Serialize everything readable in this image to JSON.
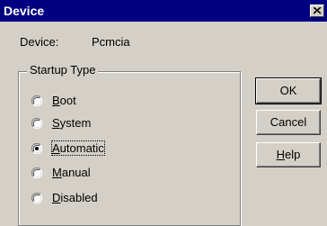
{
  "window": {
    "title": "Device"
  },
  "device": {
    "label": "Device:",
    "value": "Pcmcia"
  },
  "startup": {
    "group_label": "Startup Type",
    "options": [
      {
        "accel": "B",
        "rest": "oot",
        "selected": false
      },
      {
        "accel": "S",
        "rest": "ystem",
        "selected": false
      },
      {
        "accel": "A",
        "rest": "utomatic",
        "selected": true
      },
      {
        "accel": "M",
        "rest": "anual",
        "selected": false
      },
      {
        "accel": "D",
        "rest": "isabled",
        "selected": false
      }
    ]
  },
  "buttons": {
    "ok": "OK",
    "cancel": "Cancel",
    "help_accel": "H",
    "help_rest": "elp"
  }
}
